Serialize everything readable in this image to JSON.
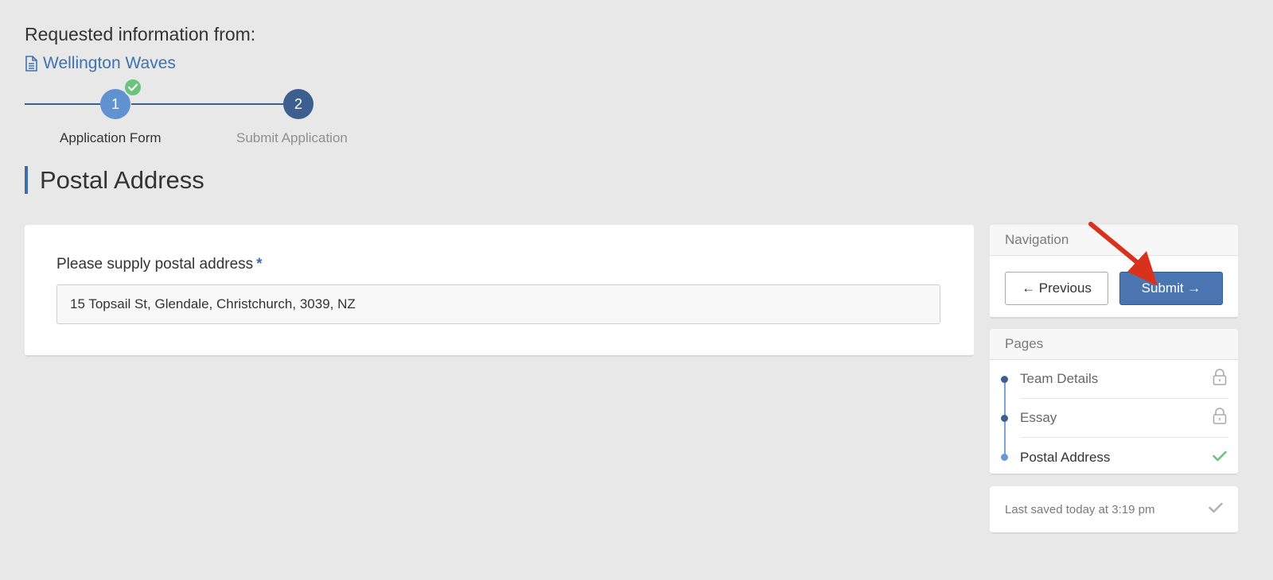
{
  "header": {
    "requested_label": "Requested information from:",
    "org_name": "Wellington Waves",
    "org_icon": "document-icon"
  },
  "stepper": {
    "steps": [
      {
        "number": "1",
        "label": "Application Form",
        "completed": true
      },
      {
        "number": "2",
        "label": "Submit Application",
        "completed": false
      }
    ]
  },
  "page": {
    "title": "Postal Address"
  },
  "form": {
    "field_label": "Please supply postal address",
    "required_marker": "*",
    "field_value": "15 Topsail St, Glendale, Christchurch, 3039, NZ"
  },
  "navigation": {
    "header": "Navigation",
    "previous_label": "← Previous",
    "submit_label": "Submit →"
  },
  "pages": {
    "header": "Pages",
    "items": [
      {
        "label": "Team Details",
        "status": "locked"
      },
      {
        "label": "Essay",
        "status": "locked"
      },
      {
        "label": "Postal Address",
        "status": "complete"
      }
    ]
  },
  "saved": {
    "text": "Last saved today at 3:19 pm",
    "icon": "check-icon"
  },
  "colors": {
    "accent": "#3e6ea8",
    "link": "#3e72b2",
    "submit": "#4a75b0",
    "success": "#6bc47d",
    "annotation_arrow": "#d9321c"
  }
}
